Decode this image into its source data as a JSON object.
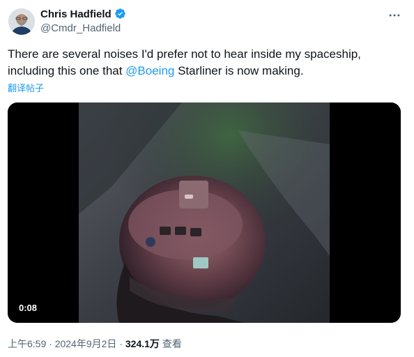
{
  "author": {
    "name": "Chris Hadfield",
    "handle": "@Cmdr_Hadfield",
    "avatar_icon": "avatar-photo",
    "verified_icon": "verified-badge-icon",
    "verified_color": "#1d9bf0"
  },
  "tweet": {
    "text_before": "There are several noises I'd prefer not to hear inside my spaceship, including this one that ",
    "mention": "@Boeing",
    "text_after": " Starliner is now making.",
    "translate_label": "翻译帖子",
    "accent_color": "#1d9bf0"
  },
  "media": {
    "type": "video",
    "duration": "0:08"
  },
  "meta": {
    "time": "上午6:59",
    "separator1": " · ",
    "date": "2024年9月2日",
    "separator2": " · ",
    "views_count": "324.1万",
    "views_label": " 查看"
  },
  "menu": {
    "more_icon": "more-dots-icon"
  }
}
